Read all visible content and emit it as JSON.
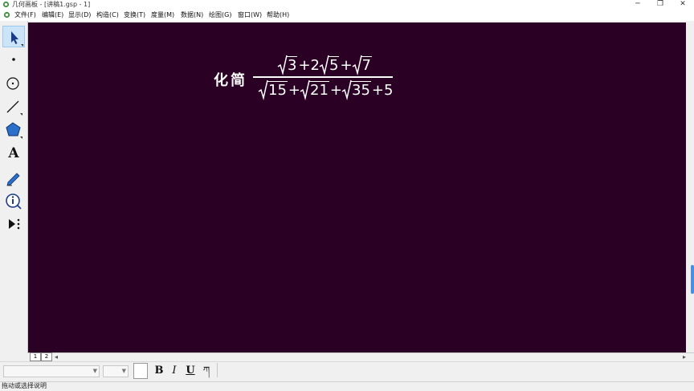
{
  "window": {
    "title": "几何画板 - [讲稿1.gsp - 1]",
    "minimize": "─",
    "restore": "❐",
    "close": "✕"
  },
  "menu": [
    "文件(F)",
    "编辑(E)",
    "显示(D)",
    "构造(C)",
    "变换(T)",
    "度量(M)",
    "数据(N)",
    "绘图(G)",
    "窗口(W)",
    "帮助(H)"
  ],
  "tools": {
    "text_tool": "A",
    "selected": "arrow"
  },
  "canvas": {
    "background": "#2b0025",
    "label": "化简",
    "numerator": {
      "r1": "3",
      "plus1": "+2",
      "r2": "5",
      "plus2": "+",
      "r3": "7"
    },
    "denominator": {
      "r1": "15",
      "plus1": "+",
      "r2": "21",
      "plus2": "+",
      "r3": "35",
      "tail": "+5"
    }
  },
  "pages": [
    "1",
    "2"
  ],
  "text_toolbar": {
    "bold": "B",
    "italic": "I",
    "underline": "U",
    "special": "ཀ"
  },
  "status": "拖动或选择说明",
  "colors": {
    "canvas": "#2b0025",
    "selection": "#cce4f7",
    "scroll_thumb": "#4a90e2"
  }
}
